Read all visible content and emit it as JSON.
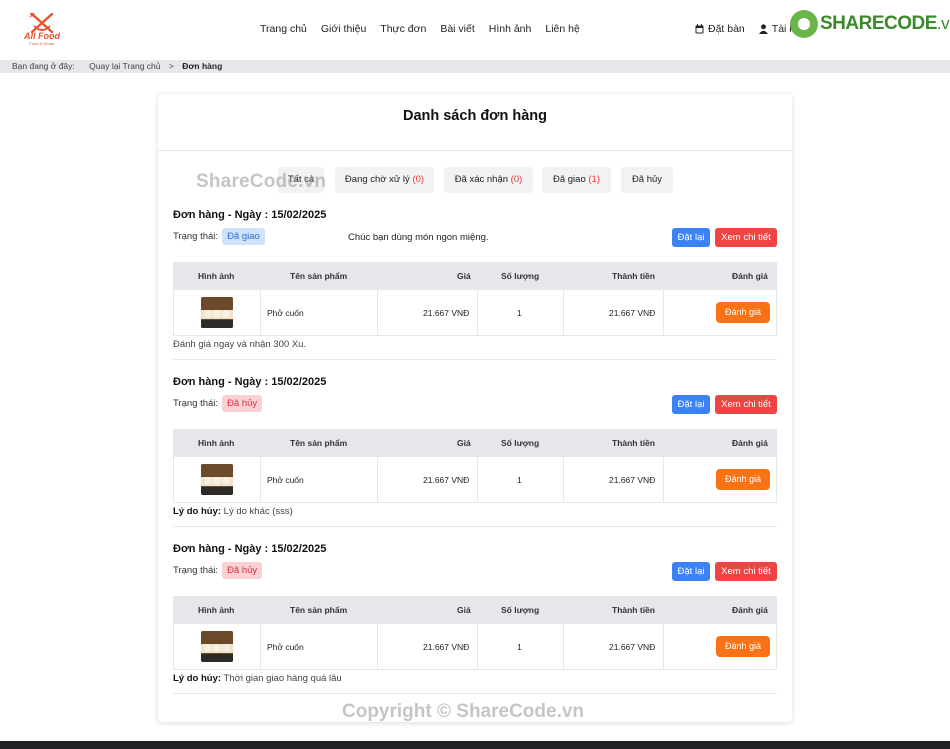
{
  "logo": {
    "brand": "All Food",
    "sub": "Food & Drinks"
  },
  "nav": [
    "Trang chủ",
    "Giới thiệu",
    "Thực đơn",
    "Bài viết",
    "Hình ảnh",
    "Liên hệ"
  ],
  "right_nav": {
    "booking": "Đặt bàn",
    "account": "Tài k"
  },
  "sharecode": {
    "brand": "SHARECODE",
    "tld": ".vn"
  },
  "breadcrumb": {
    "prefix": "Bạn đang ở đây:",
    "home": "Quay lại Trang chủ",
    "sep": ">",
    "current": "Đơn hàng"
  },
  "card": {
    "title": "Danh sách đơn hàng"
  },
  "tabs": [
    {
      "label": "Tất cả",
      "count": ""
    },
    {
      "label": "Đang chờ xử lý",
      "count": "(0)"
    },
    {
      "label": "Đã xác nhận",
      "count": "(0)"
    },
    {
      "label": "Đã giao",
      "count": "(1)"
    },
    {
      "label": "Đã hủy",
      "count": ""
    }
  ],
  "watermark": {
    "mid": "ShareCode.vn",
    "bottom": "Copyright © ShareCode.vn"
  },
  "table_headers": [
    "Hình ảnh",
    "Tên sản phẩm",
    "Giá",
    "Số lượng",
    "Thành tiền",
    "Đánh giá"
  ],
  "orders": [
    {
      "title": "Đơn hàng - Ngày : 15/02/2025",
      "status_label": "Trạng thái:",
      "status": "Đã giao",
      "note": "Chúc bạn dùng món ngon miệng.",
      "reorder": "Đặt lại",
      "detail": "Xem chi tiết",
      "item": {
        "name": "Phở cuốn",
        "price": "21.667 VNĐ",
        "qty": "1",
        "total": "21.667 VNĐ",
        "rate": "Đánh giá"
      },
      "footer_label": "",
      "footer_text": "Đánh giá ngay và nhận 300 Xu."
    },
    {
      "title": "Đơn hàng - Ngày : 15/02/2025",
      "status_label": "Trạng thái:",
      "status": "Đã hủy",
      "note": "",
      "reorder": "Đặt lại",
      "detail": "Xem chi tiết",
      "item": {
        "name": "Phở cuốn",
        "price": "21.667 VNĐ",
        "qty": "1",
        "total": "21.667 VNĐ",
        "rate": "Đánh giá"
      },
      "footer_label": "Lý do hủy:",
      "footer_text": " Lý do khác (sss)"
    },
    {
      "title": "Đơn hàng - Ngày : 15/02/2025",
      "status_label": "Trạng thái:",
      "status": "Đã hủy",
      "note": "",
      "reorder": "Đặt lại",
      "detail": "Xem chi tiết",
      "item": {
        "name": "Phở cuốn",
        "price": "21.667 VNĐ",
        "qty": "1",
        "total": "21.667 VNĐ",
        "rate": "Đánh giá"
      },
      "footer_label": "Lý do hủy:",
      "footer_text": " Thời gian giao hàng quá lâu"
    }
  ],
  "colors": {
    "accent_orange": "#f97316",
    "blue": "#3b82f6",
    "red": "#ef4444",
    "count_red": "#e53935"
  }
}
